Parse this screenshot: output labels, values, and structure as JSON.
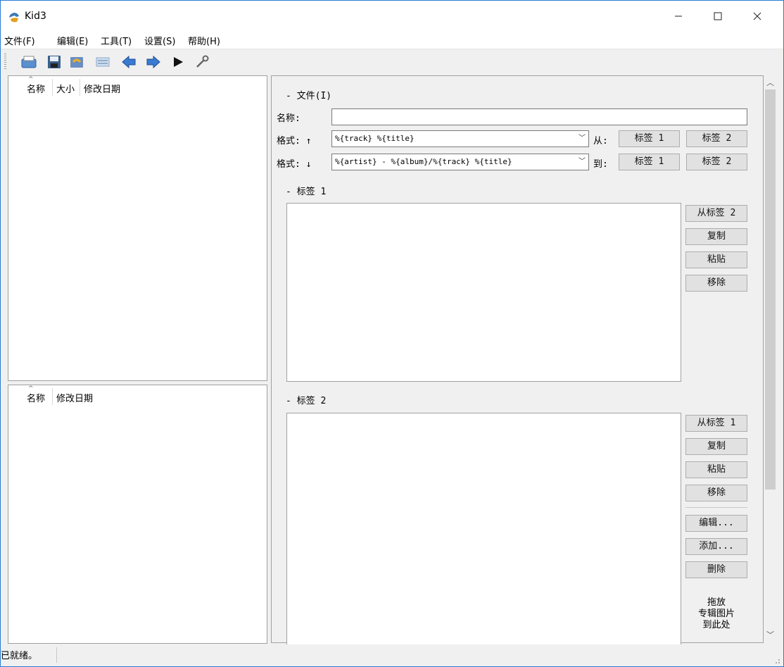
{
  "window": {
    "title": "Kid3"
  },
  "menu": [
    "文件(F)",
    "编辑(E)",
    "工具(T)",
    "设置(S)",
    "帮助(H)"
  ],
  "toolbar": {
    "icons": [
      "open-icon",
      "save-icon",
      "revert-icon",
      "list-icon",
      "previous-icon",
      "next-icon",
      "play-icon",
      "settings-icon"
    ]
  },
  "file_list": {
    "columns": [
      "名称",
      "大小",
      "修改日期"
    ]
  },
  "dir_list": {
    "columns": [
      "名称",
      "修改日期"
    ]
  },
  "file_section": {
    "header": "- 文件(I)",
    "name_label": "名称:",
    "name_value": "",
    "format_up_label": "格式: ↑",
    "format_up_value": "%{track} %{title}",
    "from_label": "从:",
    "format_down_label": "格式: ↓",
    "format_down_value": "%{artist} - %{album}/%{track} %{title}",
    "to_label": "到:",
    "tag1_btn": "标签 1",
    "tag2_btn": "标签 2"
  },
  "tag1": {
    "header": "- 标签 1",
    "buttons": [
      "从标签 2",
      "复制",
      "粘贴",
      "移除"
    ]
  },
  "tag2": {
    "header": "- 标签 2",
    "buttons": [
      "从标签 1",
      "复制",
      "粘贴",
      "移除"
    ],
    "extra_buttons": [
      "编辑...",
      "添加...",
      "删除"
    ],
    "drop_text": [
      "拖放",
      "专辑图片",
      "到此处"
    ]
  },
  "status": {
    "text": "已就绪。"
  },
  "colors": {
    "accent": "#2a7bd4",
    "panel_bg": "#f0f0f0",
    "button_bg": "#e1e1e1"
  }
}
